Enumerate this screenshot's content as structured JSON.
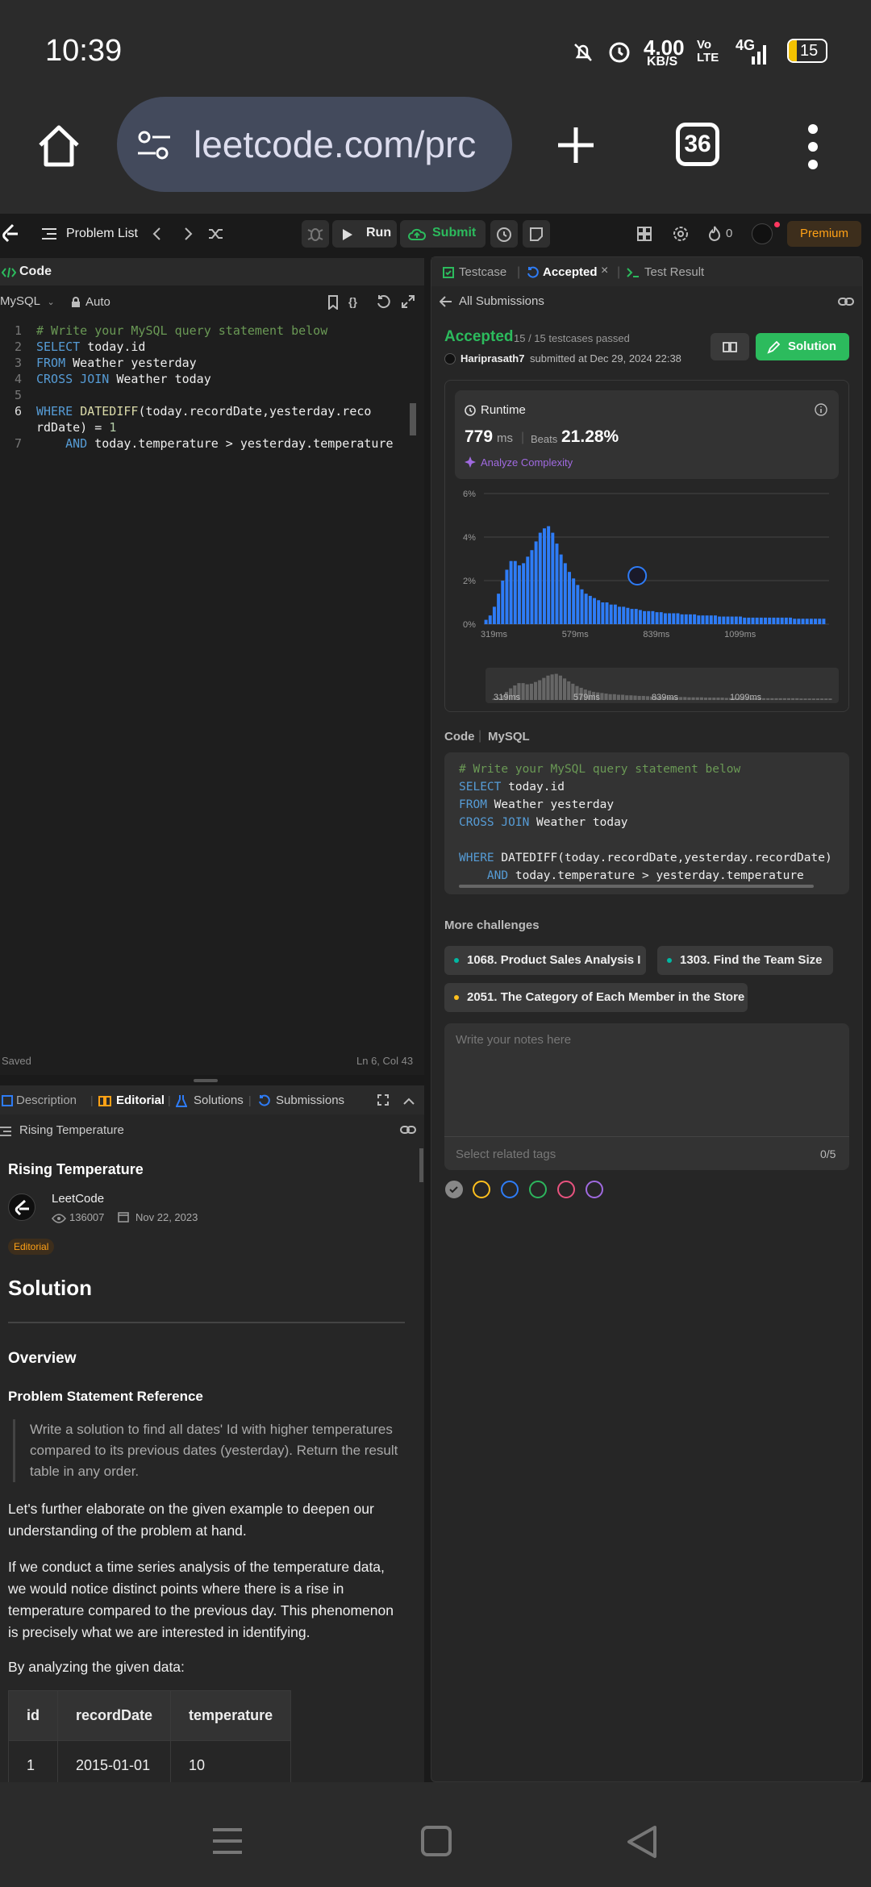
{
  "status": {
    "time": "10:39",
    "speed_value": "4.00",
    "speed_unit": "KB/S",
    "volte": "Vo LTE",
    "network": "4G",
    "battery": "15"
  },
  "browser": {
    "url": "leetcode.com/prc",
    "tab_count": "36"
  },
  "nav": {
    "problem_list": "Problem List",
    "run": "Run",
    "submit": "Submit",
    "streak": "0",
    "premium": "Premium"
  },
  "editor": {
    "tab": "Code",
    "language": "MySQL",
    "auto": "Auto",
    "lines": [
      {
        "n": "1",
        "text": "# Write your MySQL query statement below"
      },
      {
        "n": "2",
        "text": "SELECT today.id"
      },
      {
        "n": "3",
        "text": "FROM Weather yesterday"
      },
      {
        "n": "4",
        "text": "CROSS JOIN Weather today"
      },
      {
        "n": "5",
        "text": ""
      },
      {
        "n": "6",
        "text": "WHERE DATEDIFF(today.recordDate,yesterday.recordDate) = 1"
      },
      {
        "n": "7",
        "text": "    AND today.temperature > yesterday.temperature"
      }
    ],
    "saved": "Saved",
    "cursor": "Ln 6, Col 43"
  },
  "desc_tabs": {
    "description": "Description",
    "editorial": "Editorial",
    "solutions": "Solutions",
    "submissions": "Submissions"
  },
  "editorial": {
    "breadcrumb": "Rising Temperature",
    "title": "Rising Temperature",
    "author": "LeetCode",
    "views": "136007",
    "date": "Nov 22, 2023",
    "badge": "Editorial",
    "h_solution": "Solution",
    "h_overview": "Overview",
    "h_ref": "Problem Statement Reference",
    "quote": "Write a solution to find all dates' Id with higher temperatures compared to its previous dates (yesterday). Return the result table in any order.",
    "p1": "Let's further elaborate on the given example to deepen our understanding of the problem at hand.",
    "p2": "If we conduct a time series analysis of the temperature data, we would notice distinct points where there is a rise in temperature compared to the previous day. This phenomenon is precisely what we are interested in identifying.",
    "p3": "By analyzing the given data:",
    "table_headers": [
      "id",
      "recordDate",
      "temperature"
    ],
    "table_row": [
      "1",
      "2015-01-01",
      "10"
    ]
  },
  "result_tabs": {
    "testcase": "Testcase",
    "accepted": "Accepted",
    "test_result": "Test Result"
  },
  "result": {
    "all_submissions": "All Submissions",
    "status": "Accepted",
    "testcases": "15 / 15 testcases passed",
    "user": "Hariprasath7",
    "submitted": "submitted at Dec 29, 2024 22:38",
    "solution_btn": "Solution",
    "runtime_label": "Runtime",
    "runtime_value": "779",
    "runtime_unit": "ms",
    "beats_label": "Beats",
    "beats_value": "21.28%",
    "analyze": "Analyze Complexity",
    "code_label": "Code",
    "code_lang": "MySQL",
    "code_lines": [
      "# Write your MySQL query statement below",
      "SELECT today.id",
      "FROM Weather yesterday",
      "CROSS JOIN Weather today",
      "",
      "WHERE DATEDIFF(today.recordDate,yesterday.recordDate)",
      "    AND today.temperature > yesterday.temperature"
    ],
    "more_challenges": "More challenges",
    "challenges": [
      {
        "label": "1068. Product Sales Analysis I",
        "color": "#00b8a3"
      },
      {
        "label": "1303. Find the Team Size",
        "color": "#00b8a3"
      },
      {
        "label": "2051. The Category of Each Member in the Store",
        "color": "#ffc01e"
      }
    ],
    "notes_placeholder": "Write your notes here",
    "tags_placeholder": "Select related tags",
    "tags_count": "0/5",
    "color_circles": [
      "#888888",
      "#ffc01e",
      "#2e7cf6",
      "#2db55d",
      "#e9537f",
      "#a06ae0"
    ]
  },
  "chart_data": {
    "type": "bar",
    "ylim": [
      0,
      6
    ],
    "y_ticks": [
      "6%",
      "4%",
      "2%",
      "0%"
    ],
    "x_ticks": [
      "319ms",
      "579ms",
      "839ms",
      "1099ms"
    ],
    "highlight_runtime_ms": 779,
    "values": [
      0.2,
      0.4,
      0.8,
      1.4,
      2.0,
      2.5,
      2.9,
      2.9,
      2.7,
      2.8,
      3.1,
      3.4,
      3.8,
      4.2,
      4.4,
      4.5,
      4.2,
      3.7,
      3.2,
      2.8,
      2.4,
      2.1,
      1.8,
      1.6,
      1.4,
      1.3,
      1.2,
      1.1,
      1.0,
      1.0,
      0.9,
      0.9,
      0.8,
      0.8,
      0.75,
      0.7,
      0.7,
      0.65,
      0.6,
      0.6,
      0.6,
      0.55,
      0.55,
      0.5,
      0.5,
      0.5,
      0.5,
      0.45,
      0.45,
      0.45,
      0.45,
      0.4,
      0.4,
      0.4,
      0.4,
      0.4,
      0.35,
      0.35,
      0.35,
      0.35,
      0.35,
      0.35,
      0.3,
      0.3,
      0.3,
      0.3,
      0.3,
      0.3,
      0.3,
      0.3,
      0.3,
      0.3,
      0.3,
      0.3,
      0.25,
      0.25,
      0.25,
      0.25,
      0.25,
      0.25,
      0.25,
      0.25
    ]
  }
}
